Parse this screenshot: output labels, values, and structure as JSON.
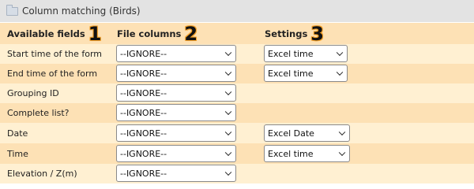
{
  "window": {
    "title": "Column matching (Birds)"
  },
  "header": {
    "col1": "Available fields",
    "col1_badge": "1",
    "col2": "File columns",
    "col2_badge": "2",
    "col3": "Settings",
    "col3_badge": "3"
  },
  "rows": [
    {
      "field": "Start time of the form",
      "column": "--IGNORE--",
      "setting": "Excel time"
    },
    {
      "field": "End time of the form",
      "column": "--IGNORE--",
      "setting": "Excel time"
    },
    {
      "field": "Grouping ID",
      "column": "--IGNORE--",
      "setting": null
    },
    {
      "field": "Complete list?",
      "column": "--IGNORE--",
      "setting": null
    },
    {
      "field": "Date",
      "column": "--IGNORE--",
      "setting": "Excel Date"
    },
    {
      "field": "Time",
      "column": "--IGNORE--",
      "setting": "Excel time"
    },
    {
      "field": "Elevation / Z(m)",
      "column": "--IGNORE--",
      "setting": null
    }
  ]
}
